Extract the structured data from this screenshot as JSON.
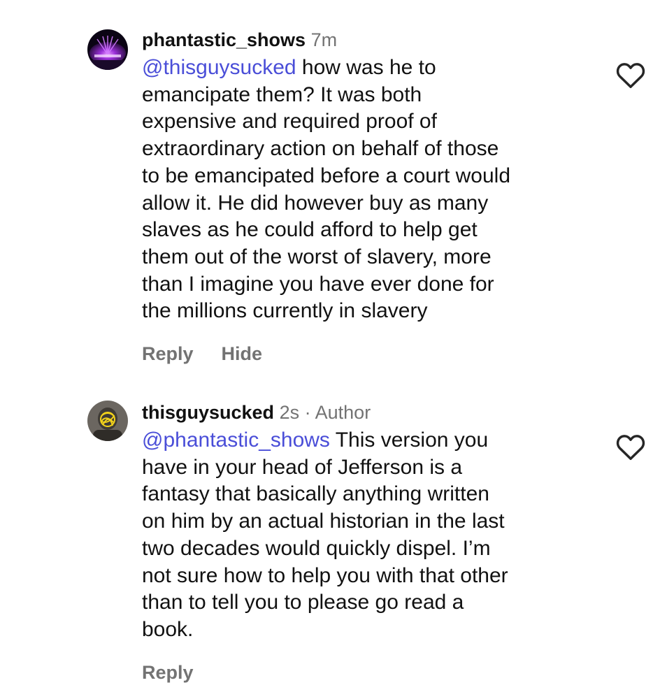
{
  "comments": [
    {
      "username": "phantastic_shows",
      "time": "7m",
      "mention": "@thisguysucked",
      "lines": [
        " how was he to",
        "emancipate them?  It was both",
        "expensive and required proof of",
        "extraordinary action on behalf of those",
        "to be emancipated before a court would",
        "allow it.  He did however buy as many",
        "slaves as he could afford to help get",
        "them out of the worst of slavery, more",
        "than I imagine you have ever done for",
        "the millions currently in slavery"
      ],
      "reply_label": "Reply",
      "hide_label": "Hide",
      "like_icon": "heart-outline-icon"
    },
    {
      "username": "thisguysucked",
      "time": "2s",
      "separator": "·",
      "badge": "Author",
      "mention": "@phantastic_shows",
      "lines": [
        " This version you",
        "have in your head of Jefferson is a",
        "fantasy that basically anything written",
        "on him by an actual historian in the last",
        "two decades would quickly dispel. I’m",
        "not sure how to help you with that other",
        "than to tell you to please go read a",
        "book."
      ],
      "reply_label": "Reply",
      "like_icon": "heart-outline-icon"
    }
  ],
  "colors": {
    "mention": "#4a4ed8",
    "muted": "#737373",
    "text": "#111111"
  }
}
